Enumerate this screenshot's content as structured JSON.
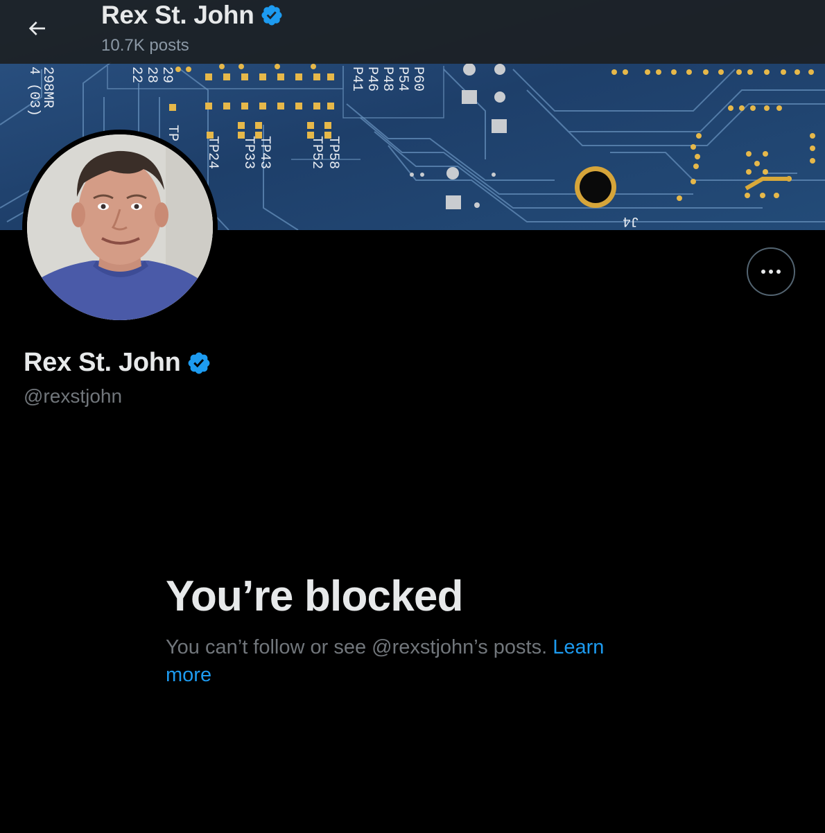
{
  "header": {
    "name": "Rex St. John",
    "posts_count": "10.7K posts",
    "back_icon": "arrow-left-icon",
    "verified_icon": "verified-badge-icon"
  },
  "banner": {
    "description_icon": "circuit-board-banner-image",
    "board_labels": [
      "P60",
      "P54",
      "P48",
      "P46",
      "P41",
      "TP 43",
      "TP 33",
      "TP 58",
      "TP 52",
      "TP 24",
      "J4",
      "298MR",
      "4 (03)"
    ]
  },
  "profile": {
    "name": "Rex St. John",
    "handle": "@rexstjohn",
    "avatar_icon": "profile-avatar-photo",
    "more_icon": "more-options-icon"
  },
  "blocked": {
    "title": "You’re blocked",
    "message": "You can’t follow or see @rexstjohn’s posts.",
    "link": "Learn more"
  },
  "colors": {
    "background": "#000000",
    "text_primary": "#e7e9ea",
    "text_secondary": "#71767b",
    "accent_blue": "#1d9bf0",
    "border": "#536471",
    "board_blue": "#20416b",
    "pad_gold": "#e6b84a"
  }
}
